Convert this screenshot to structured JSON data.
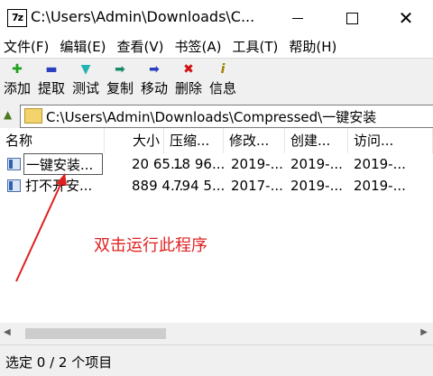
{
  "window": {
    "app_icon_text": "7z",
    "title": "C:\\Users\\Admin\\Downloads\\Compressed\\",
    "title_shown": "C:\\Users\\Admin\\Downloads\\C..."
  },
  "menu": [
    "文件(F)",
    "编辑(E)",
    "查看(V)",
    "书签(A)",
    "工具(T)",
    "帮助(H)"
  ],
  "toolbar": [
    {
      "label": "添加",
      "icon": "add-icon",
      "color": "#1fa31f",
      "glyph": "✚"
    },
    {
      "label": "提取",
      "icon": "extract-icon",
      "color": "#2a3fbf",
      "glyph": "▬"
    },
    {
      "label": "测试",
      "icon": "test-icon",
      "color": "#22b3b3",
      "glyph": "▼"
    },
    {
      "label": "复制",
      "icon": "copy-icon",
      "color": "#1a8a6a",
      "glyph": "➡"
    },
    {
      "label": "移动",
      "icon": "move-icon",
      "color": "#2a3fbf",
      "glyph": "➡"
    },
    {
      "label": "删除",
      "icon": "delete-icon",
      "color": "#d01010",
      "glyph": "✖"
    },
    {
      "label": "信息",
      "icon": "info-icon",
      "color": "#a08000",
      "glyph": "i"
    }
  ],
  "address": "C:\\Users\\Admin\\Downloads\\Compressed\\一键安装",
  "columns": [
    "名称",
    "大小",
    "压缩...",
    "修改...",
    "创建...",
    "访问..."
  ],
  "rows": [
    {
      "name": "一键安装...",
      "size": "20 65...",
      "packed": "18 96...",
      "modified": "2019-...",
      "created": "2019-...",
      "accessed": "2019-..."
    },
    {
      "name": "打不开安...",
      "size": "889 4...",
      "packed": "794 5...",
      "modified": "2017-...",
      "created": "2019-...",
      "accessed": "2019-..."
    }
  ],
  "annotation": "双击运行此程序",
  "status": "选定 0 / 2 个项目",
  "colors": {
    "annotation": "#e02020"
  }
}
